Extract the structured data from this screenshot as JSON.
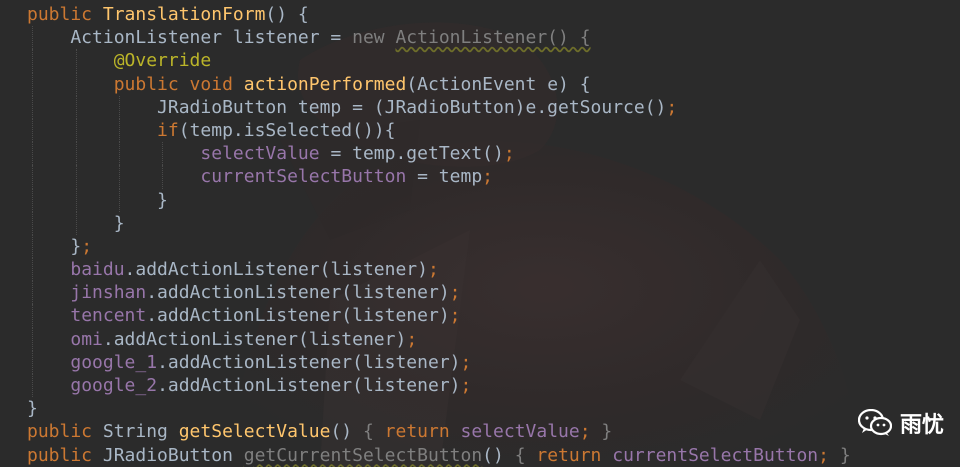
{
  "colors": {
    "background": "#2b2b2b",
    "keyword": "#cc7832",
    "method": "#ffc66d",
    "annotation": "#bbb529",
    "field": "#9876aa",
    "text": "#a9b7c6"
  },
  "code": {
    "lines": [
      [
        {
          "t": "public ",
          "k": "kw"
        },
        {
          "t": "TranslationForm",
          "k": "fn"
        },
        {
          "t": "() {",
          "k": "pl"
        }
      ],
      [
        {
          "t": "    ActionListener listener = ",
          "k": "pl"
        },
        {
          "t": "new ",
          "k": "kw dim"
        },
        {
          "t": "ActionListener() {",
          "k": "pl dim warn"
        }
      ],
      [
        {
          "t": "        ",
          "k": "pl"
        },
        {
          "t": "@Override",
          "k": "ann"
        }
      ],
      [
        {
          "t": "        ",
          "k": "pl"
        },
        {
          "t": "public void ",
          "k": "kw"
        },
        {
          "t": "actionPerformed",
          "k": "fn"
        },
        {
          "t": "(ActionEvent e) {",
          "k": "pl"
        }
      ],
      [
        {
          "t": "            JRadioButton temp = (JRadioButton)e.getSource()",
          "k": "pl"
        },
        {
          "t": ";",
          "k": "semi"
        }
      ],
      [
        {
          "t": "            ",
          "k": "pl"
        },
        {
          "t": "if",
          "k": "kw"
        },
        {
          "t": "(temp.isSelected()){",
          "k": "pl"
        }
      ],
      [
        {
          "t": "                ",
          "k": "pl"
        },
        {
          "t": "selectValue",
          "k": "fld"
        },
        {
          "t": " = temp.getText()",
          "k": "pl"
        },
        {
          "t": ";",
          "k": "semi"
        }
      ],
      [
        {
          "t": "                ",
          "k": "pl"
        },
        {
          "t": "currentSelectButton",
          "k": "fld"
        },
        {
          "t": " = temp",
          "k": "pl"
        },
        {
          "t": ";",
          "k": "semi"
        }
      ],
      [
        {
          "t": "            }",
          "k": "pl"
        }
      ],
      [
        {
          "t": "        }",
          "k": "pl"
        }
      ],
      [
        {
          "t": "    }",
          "k": "pl"
        },
        {
          "t": ";",
          "k": "semi"
        }
      ],
      [
        {
          "t": "    ",
          "k": "pl"
        },
        {
          "t": "baidu",
          "k": "fld"
        },
        {
          "t": ".addActionListener(listener)",
          "k": "pl"
        },
        {
          "t": ";",
          "k": "semi"
        }
      ],
      [
        {
          "t": "    ",
          "k": "pl"
        },
        {
          "t": "jinshan",
          "k": "fld"
        },
        {
          "t": ".addActionListener(listener)",
          "k": "pl"
        },
        {
          "t": ";",
          "k": "semi"
        }
      ],
      [
        {
          "t": "    ",
          "k": "pl"
        },
        {
          "t": "tencent",
          "k": "fld"
        },
        {
          "t": ".addActionListener(listener)",
          "k": "pl"
        },
        {
          "t": ";",
          "k": "semi"
        }
      ],
      [
        {
          "t": "    ",
          "k": "pl"
        },
        {
          "t": "omi",
          "k": "fld"
        },
        {
          "t": ".addActionListener(listener)",
          "k": "pl"
        },
        {
          "t": ";",
          "k": "semi"
        }
      ],
      [
        {
          "t": "    ",
          "k": "pl"
        },
        {
          "t": "google_1",
          "k": "fld"
        },
        {
          "t": ".addActionListener(listener)",
          "k": "pl"
        },
        {
          "t": ";",
          "k": "semi"
        }
      ],
      [
        {
          "t": "    ",
          "k": "pl"
        },
        {
          "t": "google_2",
          "k": "fld"
        },
        {
          "t": ".addActionListener(listener)",
          "k": "pl"
        },
        {
          "t": ";",
          "k": "semi"
        }
      ],
      [
        {
          "t": "}",
          "k": "pl"
        }
      ],
      [
        {
          "t": "public ",
          "k": "kw"
        },
        {
          "t": "String ",
          "k": "pl"
        },
        {
          "t": "getSelectValue",
          "k": "fn"
        },
        {
          "t": "() ",
          "k": "pl"
        },
        {
          "t": "{ ",
          "k": "dim"
        },
        {
          "t": "return ",
          "k": "kw"
        },
        {
          "t": "selectValue",
          "k": "fld"
        },
        {
          "t": "; ",
          "k": "semi"
        },
        {
          "t": "}",
          "k": "dim"
        }
      ],
      [
        {
          "t": "public ",
          "k": "kw"
        },
        {
          "t": "JRadioButton ",
          "k": "pl"
        },
        {
          "t": "getCurrentSelectButton",
          "k": "fn dim warn"
        },
        {
          "t": "() ",
          "k": "pl"
        },
        {
          "t": "{ ",
          "k": "dim"
        },
        {
          "t": "return ",
          "k": "kw"
        },
        {
          "t": "currentSelectButton",
          "k": "fld"
        },
        {
          "t": "; ",
          "k": "semi"
        },
        {
          "t": "}",
          "k": "dim"
        }
      ]
    ]
  },
  "watermark": {
    "icon": "wechat-icon",
    "label": "雨忧"
  }
}
